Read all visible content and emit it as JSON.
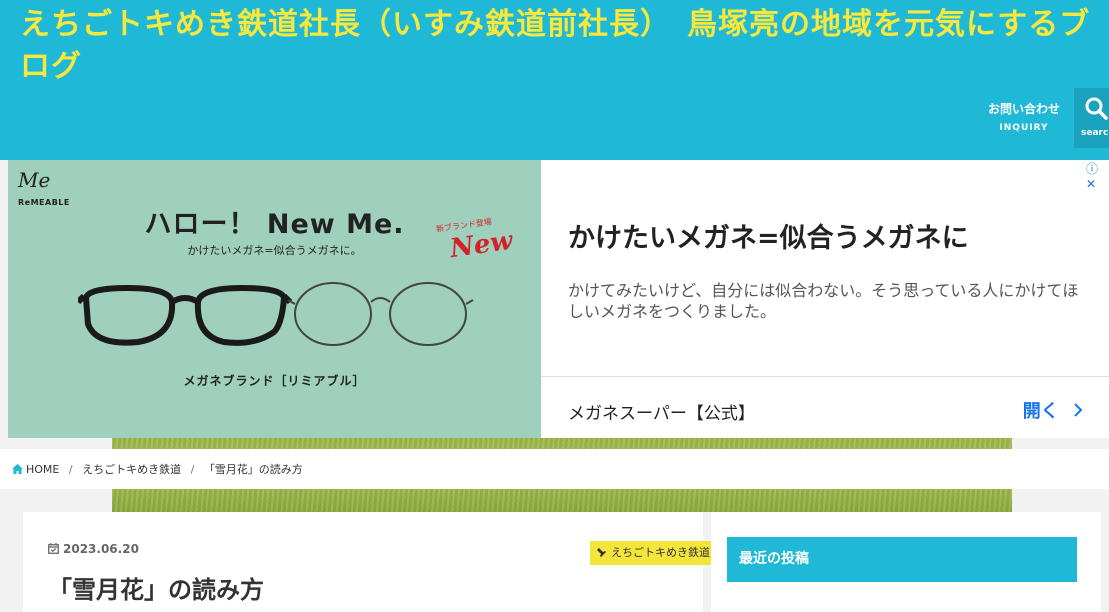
{
  "header": {
    "site_title": "えちごトキめき鉄道社長（いすみ鉄道前社長）　鳥塚亮の地域を元気にするブログ",
    "inquiry_label": "お問い合わせ",
    "inquiry_en": "INQUIRY",
    "search_label": "search"
  },
  "ad": {
    "brand_mark": "Me",
    "brand_name": "ReMEABLE",
    "headline": "ハロー！ New Me.",
    "subline": "かけたいメガネ=似合うメガネに。",
    "new_small": "新ブランド登場",
    "new_big": "New",
    "product_brand": "メガネブランド［リミアブル］",
    "title": "かけたいメガネ=似合うメガネに",
    "description": "かけてみたいけど、自分には似合わない。そう思っている人にかけてほしいメガネをつくりました。",
    "advertiser": "メガネスーパー【公式】",
    "open_label": "開く",
    "info_icon": "ⓘ",
    "close_icon": "✕"
  },
  "breadcrumb": {
    "home": "HOME",
    "category": "えちごトキめき鉄道",
    "current": "「雪月花」の読み方"
  },
  "post": {
    "date": "2023.06.20",
    "title": "「雪月花」の読み方",
    "category": "えちごトキめき鉄道"
  },
  "sidebar": {
    "recent_posts_title": "最近の投稿"
  },
  "colors": {
    "header_bg": "#1fb8d6",
    "title_yellow": "#f6e83c",
    "category_yellow": "#f3e53a",
    "ad_link_blue": "#1a73e8"
  }
}
